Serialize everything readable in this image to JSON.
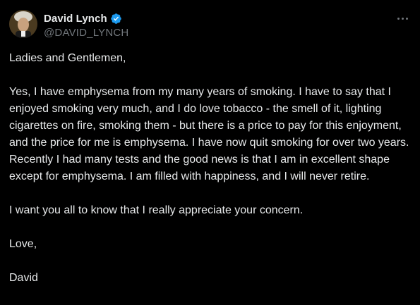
{
  "author": {
    "display_name": "David Lynch",
    "handle": "@DAVID_LYNCH",
    "verified": true
  },
  "icons": {
    "verified": "verified-badge-icon",
    "more": "more-options-icon"
  },
  "colors": {
    "background": "#000000",
    "text": "#e7e9ea",
    "secondary_text": "#71767b",
    "verified_blue": "#1d9bf0"
  },
  "post": {
    "paragraphs": [
      "Ladies and Gentlemen,",
      "Yes, I have emphysema from my many years of smoking. I have to say that I enjoyed smoking very much, and I do love tobacco - the smell of it, lighting cigarettes on fire, smoking them - but there is a price to pay for this enjoyment, and the price for me is emphysema. I have now quit smoking for over two years. Recently I had many tests and the good news is that I am in excellent shape except for emphysema. I am filled with happiness, and I will never retire.",
      "I want you all to know that I really appreciate your concern.",
      "Love,",
      "David"
    ]
  }
}
